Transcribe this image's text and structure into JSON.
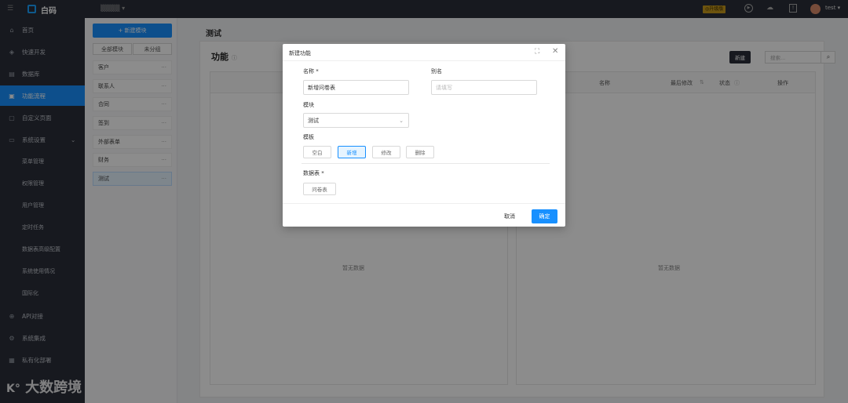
{
  "brand": {
    "name": "白码",
    "project": "▒▒▒▒"
  },
  "topbar": {
    "badge": "◎升级版",
    "user": "test"
  },
  "sidebar": {
    "items": [
      {
        "label": "首页",
        "icon": "home-icon"
      },
      {
        "label": "快速开发",
        "icon": "cube-icon"
      },
      {
        "label": "数据库",
        "icon": "database-icon"
      },
      {
        "label": "功能流程",
        "icon": "flow-icon"
      },
      {
        "label": "自定义页面",
        "icon": "page-icon"
      },
      {
        "label": "系统设置",
        "icon": "monitor-icon"
      }
    ],
    "sub_items": [
      "菜单管理",
      "权限管理",
      "用户管理",
      "定时任务",
      "数据表高级配置",
      "系统使用情况",
      "国际化"
    ],
    "more_items": [
      {
        "label": "API对接",
        "icon": "api-icon"
      },
      {
        "label": "系统集成",
        "icon": "integration-icon"
      },
      {
        "label": "私有化部署",
        "icon": "server-icon"
      }
    ]
  },
  "modules": {
    "new_label": "+ 新建模块",
    "tab_all": "全部模块",
    "tab_ungrouped": "未分组",
    "items": [
      "客户",
      "联系人",
      "合同",
      "签到",
      "外部表单",
      "财务",
      "测试"
    ],
    "more": "···"
  },
  "page": {
    "title": "测试",
    "card_title": "功能",
    "new_btn": "新建",
    "search_placeholder": "搜索...",
    "columns": [
      "名称",
      "最后修改",
      "状态",
      "操作"
    ],
    "empty": "暂无数据"
  },
  "modal": {
    "title": "新建功能",
    "name_label": "名称",
    "required_mark": "*",
    "alias_label": "别名",
    "name_value": "新增问卷表",
    "alias_placeholder": "请填写",
    "module_label": "模块",
    "module_value": "测试",
    "template_label": "模板",
    "templates": [
      "空白",
      "新增",
      "修改",
      "删除"
    ],
    "table_label": "数据表",
    "table_value": "问卷表",
    "cancel": "取消",
    "ok": "确定"
  },
  "watermark": "大数跨境"
}
